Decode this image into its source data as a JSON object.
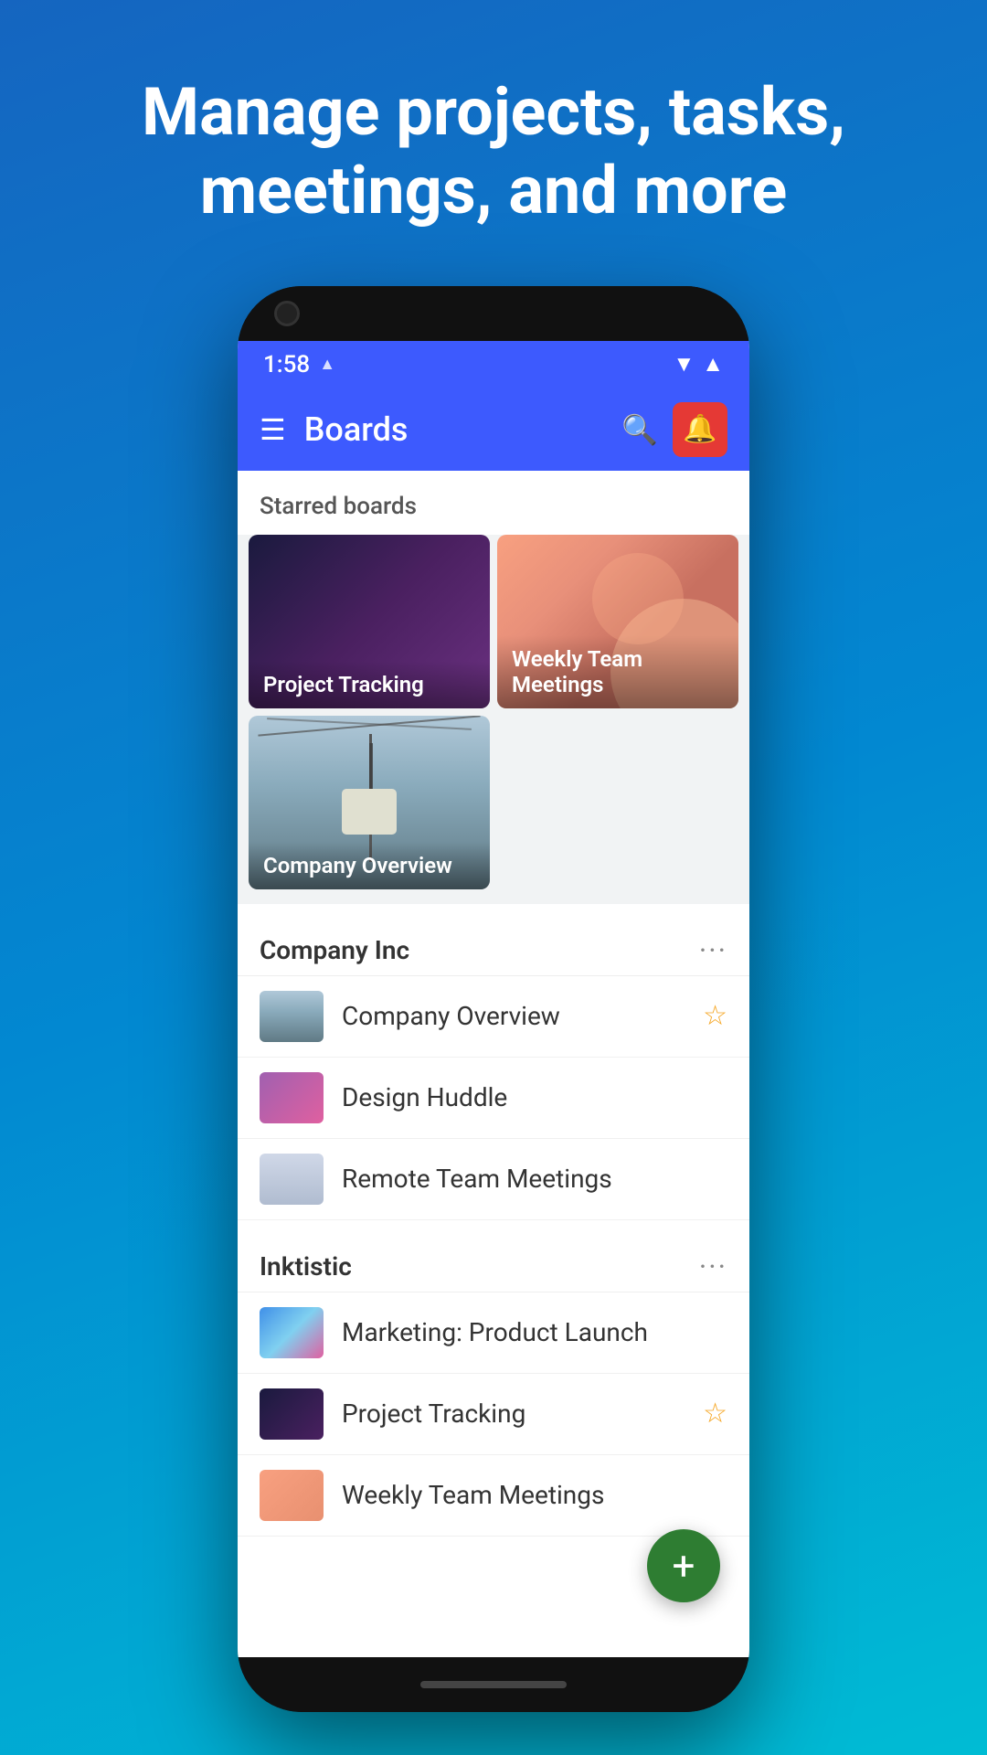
{
  "headline": "Manage projects, tasks, meetings, and more",
  "status_bar": {
    "time": "1:58",
    "wifi": "▲",
    "signal": "▲"
  },
  "toolbar": {
    "title": "Boards",
    "hamburger_label": "☰",
    "search_label": "🔍",
    "notification_label": "🔔"
  },
  "starred_boards": {
    "section_label": "Starred boards",
    "cards": [
      {
        "name": "Project Tracking",
        "bg_class": "bg-project-tracking"
      },
      {
        "name": "Weekly Team Meetings",
        "bg_class": "bg-weekly-meetings"
      },
      {
        "name": "Company Overview",
        "bg_class": "bg-company-overview"
      }
    ]
  },
  "workspaces": [
    {
      "name": "Company Inc",
      "more_label": "···",
      "boards": [
        {
          "name": "Company Overview",
          "thumb": "thumb-company-overview",
          "starred": true
        },
        {
          "name": "Design Huddle",
          "thumb": "thumb-design-huddle",
          "starred": false
        },
        {
          "name": "Remote Team Meetings",
          "thumb": "thumb-remote-meetings",
          "starred": false
        }
      ]
    },
    {
      "name": "Inktistic",
      "more_label": "···",
      "boards": [
        {
          "name": "Marketing: Product Launch",
          "thumb": "thumb-marketing",
          "starred": false
        },
        {
          "name": "Project Tracking",
          "thumb": "thumb-project-tracking",
          "starred": true
        },
        {
          "name": "Weekly Team Meetings",
          "thumb": "thumb-weekly-meetings-inktistic",
          "starred": false
        }
      ]
    }
  ],
  "fab": {
    "label": "+"
  }
}
